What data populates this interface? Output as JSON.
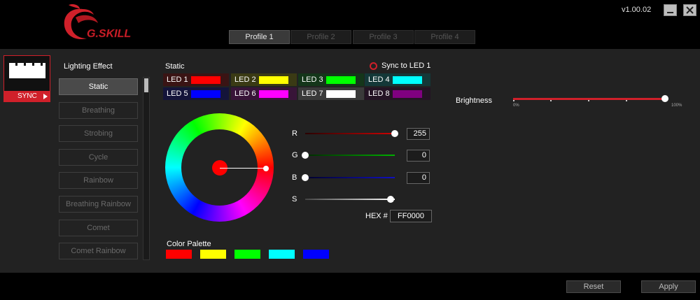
{
  "app": {
    "version": "v1.00.02",
    "logo_text": "G.SKILL"
  },
  "profiles": [
    {
      "label": "Profile 1",
      "active": true
    },
    {
      "label": "Profile 2",
      "active": false
    },
    {
      "label": "Profile 3",
      "active": false
    },
    {
      "label": "Profile 4",
      "active": false
    }
  ],
  "device": {
    "sync_label": "SYNC"
  },
  "lighting": {
    "title": "Lighting Effect",
    "effects": [
      "Static",
      "Breathing",
      "Strobing",
      "Cycle",
      "Rainbow",
      "Breathing Rainbow",
      "Comet",
      "Comet Rainbow"
    ],
    "selected": "Static"
  },
  "static_panel": {
    "title": "Static",
    "sync_led1_label": "Sync to LED 1",
    "leds": [
      {
        "label": "LED 1",
        "color": "#ff0000",
        "bg": "#3a1414"
      },
      {
        "label": "LED 2",
        "color": "#ffff00",
        "bg": "#3a3a14"
      },
      {
        "label": "LED 3",
        "color": "#00ff00",
        "bg": "#14361a"
      },
      {
        "label": "LED 4",
        "color": "#00ffff",
        "bg": "#143838"
      },
      {
        "label": "LED 5",
        "color": "#0000ff",
        "bg": "#14143a"
      },
      {
        "label": "LED 6",
        "color": "#ff00ff",
        "bg": "#381438"
      },
      {
        "label": "LED 7",
        "color": "#ffffff",
        "bg": "#3a3a3a"
      },
      {
        "label": "LED 8",
        "color": "#800080",
        "bg": "#241424"
      }
    ]
  },
  "color": {
    "r_label": "R",
    "r_value": "255",
    "r_fraction": 1.0,
    "g_label": "G",
    "g_value": "0",
    "g_fraction": 0.0,
    "b_label": "B",
    "b_value": "0",
    "b_fraction": 0.0,
    "s_label": "S",
    "s_fraction": 1.0,
    "hex_label": "HEX #",
    "hex_value": "FF0000"
  },
  "palette": {
    "title": "Color Palette",
    "colors": [
      "#ff0000",
      "#ffff00",
      "#00ff00",
      "#00ffff",
      "#0000ff"
    ]
  },
  "brightness": {
    "label": "Brightness",
    "min_label": "0%",
    "max_label": "100%",
    "value_percent": 100
  },
  "footer": {
    "reset_label": "Reset",
    "apply_label": "Apply"
  },
  "accent_color": "#d0202a"
}
